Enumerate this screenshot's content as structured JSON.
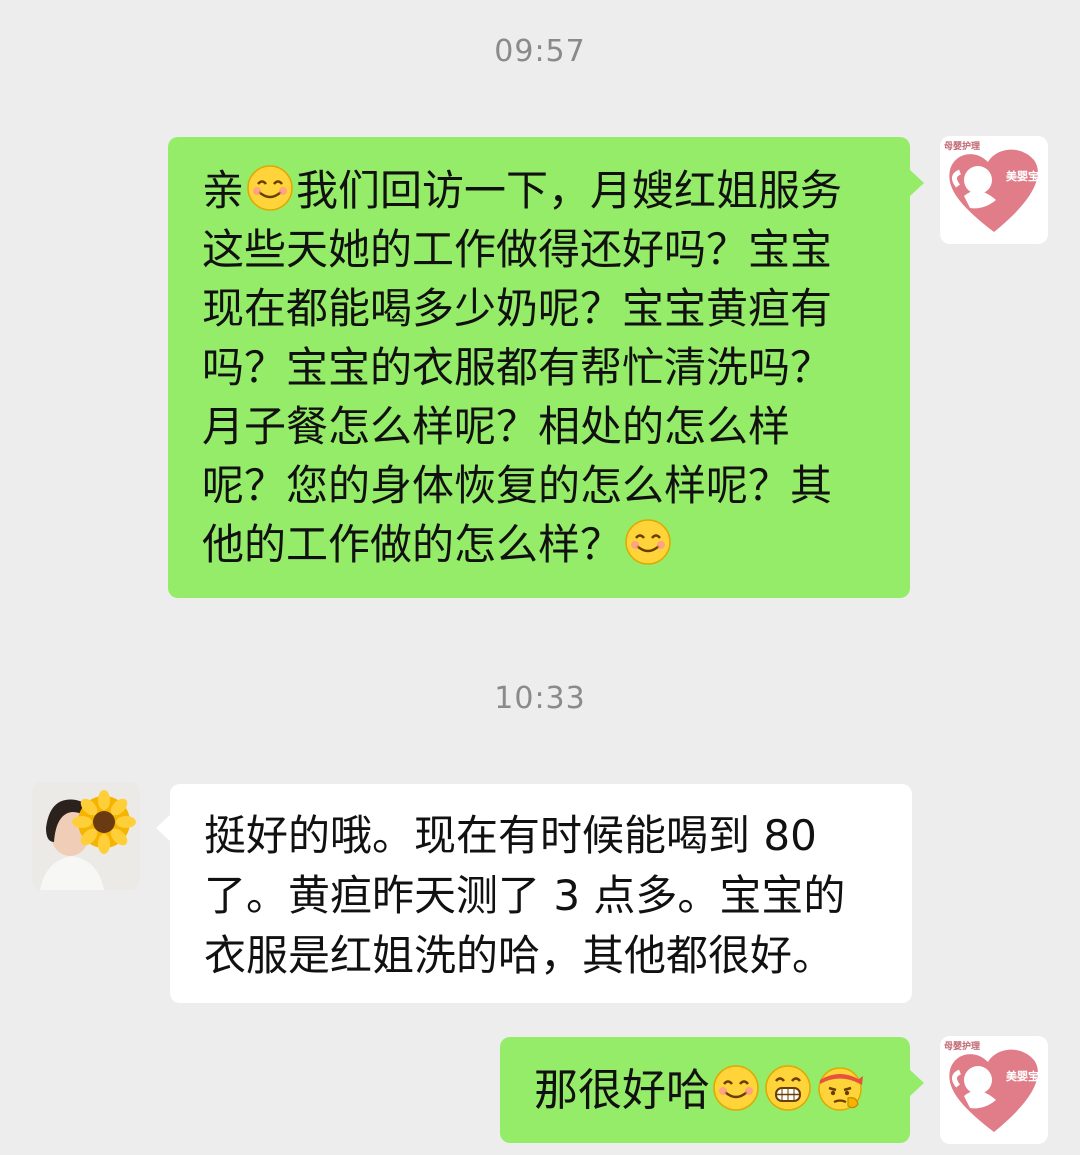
{
  "chat": {
    "timestamps": [
      "09:57",
      "10:33"
    ],
    "messages": [
      {
        "from": "self",
        "segments": [
          [
            "亲",
            "{smile}",
            "我们回访一下，月嫂红姐服务"
          ],
          [
            "这些天她的工作做得还好吗？宝宝"
          ],
          [
            "现在都能喝多少奶呢？宝宝黄疸有"
          ],
          [
            "吗？宝宝的衣服都有帮忙清洗吗？"
          ],
          [
            "月子餐怎么样呢？相处的怎么样"
          ],
          [
            "呢？您的身体恢复的怎么样呢？其"
          ],
          [
            "他的工作做的怎么样？",
            "{smile}"
          ]
        ]
      },
      {
        "from": "other",
        "lines": [
          "挺好的哦。现在有时候能喝到 80",
          "了。黄疸昨天测了 3 点多。宝宝的",
          "衣服是红姐洗的哈，其他都很好。"
        ]
      },
      {
        "from": "self",
        "text": "那很好哈",
        "emojis": [
          "smile-emoji",
          "grin-emoji",
          "determined-emoji"
        ]
      }
    ]
  },
  "self_avatar": {
    "logo_caption": "母婴护理",
    "heart_text": "美婴宝贝"
  },
  "colors": {
    "self_bubble": "#95ec69",
    "other_bubble": "#ffffff",
    "background": "#ededed"
  }
}
